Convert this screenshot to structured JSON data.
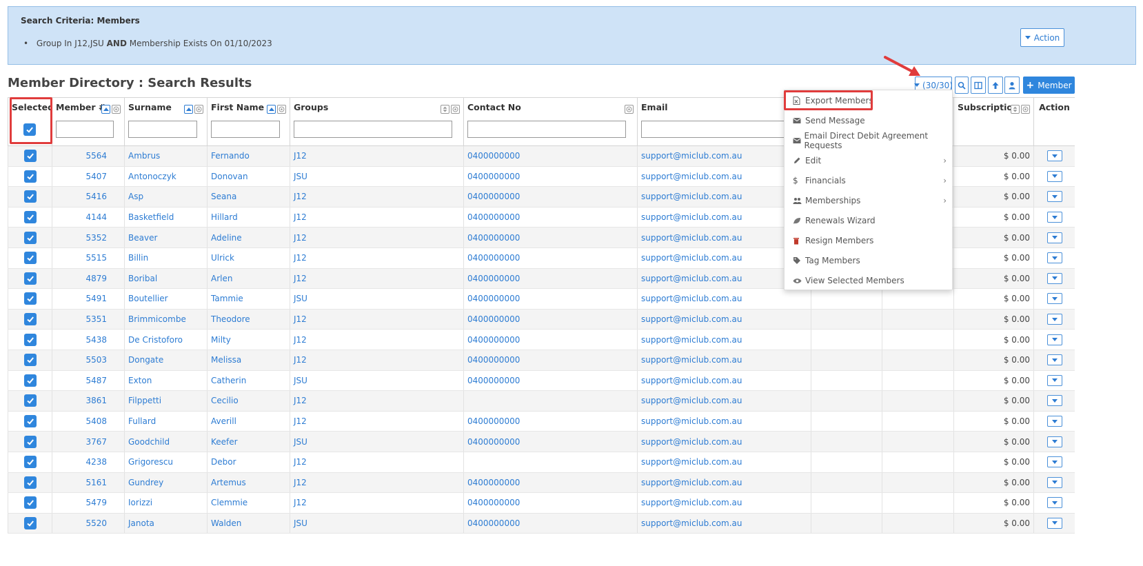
{
  "criteria": {
    "title": "Search Criteria: Members",
    "line_prefix": "Group In J12,JSU",
    "line_and": "AND",
    "line_suffix": "Membership Exists On 01/10/2023",
    "action_label": "Action"
  },
  "page": {
    "title": "Member Directory : Search Results"
  },
  "toolbar": {
    "count_label": "(30/30)",
    "member_label": "Member",
    "accent": "#2f86dd",
    "annotation_color": "#e03c3c"
  },
  "columns": {
    "selected": "Selected",
    "member_no": "Member #",
    "surname": "Surname",
    "first_name": "First Name",
    "groups": "Groups",
    "contact": "Contact No",
    "email": "Email",
    "subscription": "Subscription",
    "action": "Action"
  },
  "rows": [
    {
      "no": "5564",
      "surname": "Ambrus",
      "first": "Fernando",
      "group": "J12",
      "contact": "0400000000",
      "email": "support@miclub.com.au",
      "sub": "$ 0.00"
    },
    {
      "no": "5407",
      "surname": "Antonoczyk",
      "first": "Donovan",
      "group": "JSU",
      "contact": "0400000000",
      "email": "support@miclub.com.au",
      "sub": "$ 0.00"
    },
    {
      "no": "5416",
      "surname": "Asp",
      "first": "Seana",
      "group": "J12",
      "contact": "0400000000",
      "email": "support@miclub.com.au",
      "sub": "$ 0.00"
    },
    {
      "no": "4144",
      "surname": "Basketfield",
      "first": "Hillard",
      "group": "J12",
      "contact": "0400000000",
      "email": "support@miclub.com.au",
      "sub": "$ 0.00"
    },
    {
      "no": "5352",
      "surname": "Beaver",
      "first": "Adeline",
      "group": "J12",
      "contact": "0400000000",
      "email": "support@miclub.com.au",
      "sub": "$ 0.00"
    },
    {
      "no": "5515",
      "surname": "Billin",
      "first": "Ulrick",
      "group": "J12",
      "contact": "0400000000",
      "email": "support@miclub.com.au",
      "sub": "$ 0.00"
    },
    {
      "no": "4879",
      "surname": "Boribal",
      "first": "Arlen",
      "group": "J12",
      "contact": "0400000000",
      "email": "support@miclub.com.au",
      "sub": "$ 0.00"
    },
    {
      "no": "5491",
      "surname": "Boutellier",
      "first": "Tammie",
      "group": "JSU",
      "contact": "0400000000",
      "email": "support@miclub.com.au",
      "sub": "$ 0.00"
    },
    {
      "no": "5351",
      "surname": "Brimmicombe",
      "first": "Theodore",
      "group": "J12",
      "contact": "0400000000",
      "email": "support@miclub.com.au",
      "sub": "$ 0.00"
    },
    {
      "no": "5438",
      "surname": "De Cristoforo",
      "first": "Milty",
      "group": "J12",
      "contact": "0400000000",
      "email": "support@miclub.com.au",
      "sub": "$ 0.00"
    },
    {
      "no": "5503",
      "surname": "Dongate",
      "first": "Melissa",
      "group": "J12",
      "contact": "0400000000",
      "email": "support@miclub.com.au",
      "sub": "$ 0.00"
    },
    {
      "no": "5487",
      "surname": "Exton",
      "first": "Catherin",
      "group": "JSU",
      "contact": "0400000000",
      "email": "support@miclub.com.au",
      "sub": "$ 0.00"
    },
    {
      "no": "3861",
      "surname": "Filppetti",
      "first": "Cecilio",
      "group": "J12",
      "contact": "",
      "email": "support@miclub.com.au",
      "sub": "$ 0.00"
    },
    {
      "no": "5408",
      "surname": "Fullard",
      "first": "Averill",
      "group": "J12",
      "contact": "0400000000",
      "email": "support@miclub.com.au",
      "sub": "$ 0.00"
    },
    {
      "no": "3767",
      "surname": "Goodchild",
      "first": "Keefer",
      "group": "JSU",
      "contact": "0400000000",
      "email": "support@miclub.com.au",
      "sub": "$ 0.00"
    },
    {
      "no": "4238",
      "surname": "Grigorescu",
      "first": "Debor",
      "group": "J12",
      "contact": "",
      "email": "support@miclub.com.au",
      "sub": "$ 0.00"
    },
    {
      "no": "5161",
      "surname": "Gundrey",
      "first": "Artemus",
      "group": "J12",
      "contact": "0400000000",
      "email": "support@miclub.com.au",
      "sub": "$ 0.00"
    },
    {
      "no": "5479",
      "surname": "Iorizzi",
      "first": "Clemmie",
      "group": "J12",
      "contact": "0400000000",
      "email": "support@miclub.com.au",
      "sub": "$ 0.00"
    },
    {
      "no": "5520",
      "surname": "Janota",
      "first": "Walden",
      "group": "JSU",
      "contact": "0400000000",
      "email": "support@miclub.com.au",
      "sub": "$ 0.00"
    }
  ],
  "menu": {
    "items": [
      {
        "label": "Export Members",
        "icon": "file-excel-icon",
        "submenu": false
      },
      {
        "label": "Send Message",
        "icon": "envelope-icon",
        "submenu": false
      },
      {
        "label": "Email Direct Debit Agreement Requests",
        "icon": "envelope-icon",
        "submenu": false
      },
      {
        "label": "Edit",
        "icon": "pencil-icon",
        "submenu": true
      },
      {
        "label": "Financials",
        "icon": "dollar-icon",
        "submenu": true
      },
      {
        "label": "Memberships",
        "icon": "users-icon",
        "submenu": true
      },
      {
        "label": "Renewals Wizard",
        "icon": "leaf-icon",
        "submenu": false
      },
      {
        "label": "Resign Members",
        "icon": "trash-icon",
        "submenu": false
      },
      {
        "label": "Tag Members",
        "icon": "tag-icon",
        "submenu": false
      },
      {
        "label": "View Selected Members",
        "icon": "eye-icon",
        "submenu": false
      }
    ]
  }
}
